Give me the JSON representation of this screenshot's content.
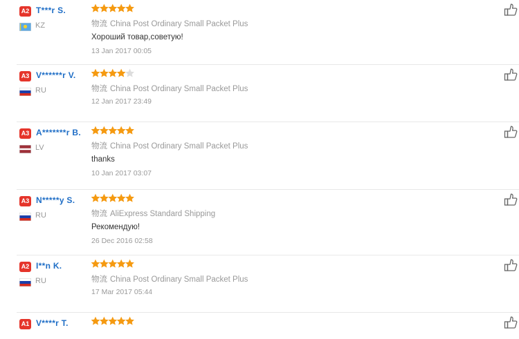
{
  "reviews": [
    {
      "badge": "A2",
      "name": "T***r S.",
      "country": "KZ",
      "flag": "kz",
      "rating": 5,
      "logistics_label": "物流",
      "logistics": "China Post Ordinary Small Packet Plus",
      "comment": "Хороший товар,советую!",
      "date": "13 Jan 2017 00:05"
    },
    {
      "badge": "A3",
      "name": "V******r V.",
      "country": "RU",
      "flag": "ru",
      "rating": 4,
      "logistics_label": "物流",
      "logistics": "China Post Ordinary Small Packet Plus",
      "comment": "",
      "date": "12 Jan 2017 23:49"
    },
    {
      "badge": "A3",
      "name": "A*******r B.",
      "country": "LV",
      "flag": "lv",
      "rating": 5,
      "logistics_label": "物流",
      "logistics": "China Post Ordinary Small Packet Plus",
      "comment": "thanks",
      "date": "10 Jan 2017 03:07"
    },
    {
      "badge": "A3",
      "name": "N*****y S.",
      "country": "RU",
      "flag": "ru",
      "rating": 5,
      "logistics_label": "物流",
      "logistics": "AliExpress Standard Shipping",
      "comment": "Рекомендую!",
      "date": "26 Dec 2016 02:58"
    },
    {
      "badge": "A2",
      "name": "I**n K.",
      "country": "RU",
      "flag": "ru",
      "rating": 5,
      "logistics_label": "物流",
      "logistics": "China Post Ordinary Small Packet Plus",
      "comment": "",
      "date": "17 Mar 2017 05:44"
    },
    {
      "badge": "A1",
      "name": "V****r T.",
      "country": "",
      "flag": "",
      "rating": 5,
      "logistics_label": "",
      "logistics": "",
      "comment": "",
      "date": ""
    }
  ],
  "colors": {
    "star_on": "#f59a11",
    "star_off": "#dddddd",
    "badge": "#e5352b",
    "name": "#1f6ec6"
  },
  "icons": {
    "thumb": "thumbs-up-icon",
    "star": "star-icon"
  }
}
